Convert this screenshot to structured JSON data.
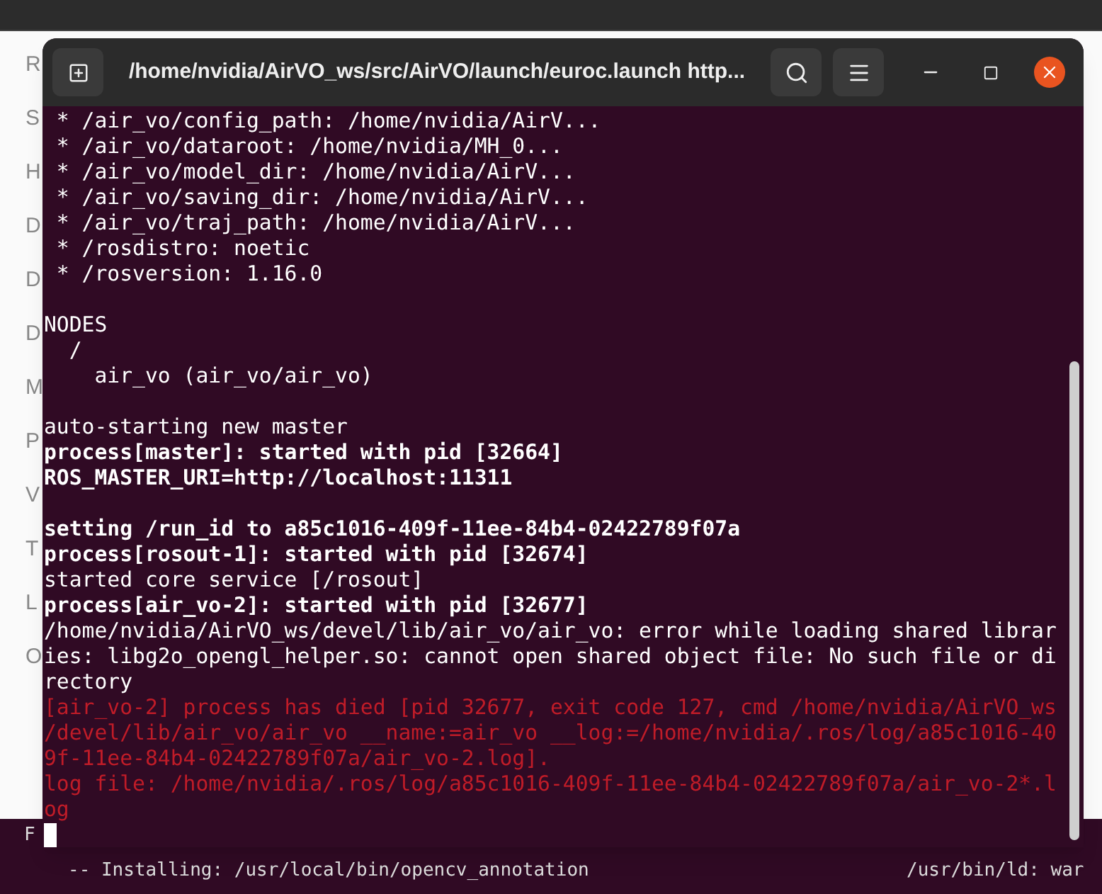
{
  "file_manager": {
    "sidebar_items": [
      {
        "label": "R"
      },
      {
        "label": "S"
      },
      {
        "label": "H"
      },
      {
        "label": "D"
      },
      {
        "label": "D"
      },
      {
        "label": "D"
      },
      {
        "label": "M"
      },
      {
        "label": "P"
      },
      {
        "label": "V"
      },
      {
        "label": "T"
      },
      {
        "label": "L"
      },
      {
        "label": "O"
      }
    ]
  },
  "back_terminal": {
    "lines": [
      "F",
      "-- Installing: /usr/local/bin/opencv_annotation"
    ],
    "right_text": "/usr/bin/ld: war"
  },
  "terminal": {
    "title": "/home/nvidia/AirVO_ws/src/AirVO/launch/euroc.launch http...",
    "lines": [
      {
        "kind": "normal",
        "text": " * /air_vo/config_path: /home/nvidia/AirV..."
      },
      {
        "kind": "normal",
        "text": " * /air_vo/dataroot: /home/nvidia/MH_0..."
      },
      {
        "kind": "normal",
        "text": " * /air_vo/model_dir: /home/nvidia/AirV..."
      },
      {
        "kind": "normal",
        "text": " * /air_vo/saving_dir: /home/nvidia/AirV..."
      },
      {
        "kind": "normal",
        "text": " * /air_vo/traj_path: /home/nvidia/AirV..."
      },
      {
        "kind": "normal",
        "text": " * /rosdistro: noetic"
      },
      {
        "kind": "normal",
        "text": " * /rosversion: 1.16.0"
      },
      {
        "kind": "gap"
      },
      {
        "kind": "normal",
        "text": "NODES"
      },
      {
        "kind": "normal",
        "text": "  /"
      },
      {
        "kind": "normal",
        "text": "    air_vo (air_vo/air_vo)"
      },
      {
        "kind": "gap"
      },
      {
        "kind": "normal",
        "text": "auto-starting new master"
      },
      {
        "kind": "bold",
        "text": "process[master]: started with pid [32664]"
      },
      {
        "kind": "bold",
        "text": "ROS_MASTER_URI=http://localhost:11311"
      },
      {
        "kind": "gap"
      },
      {
        "kind": "bold",
        "text": "setting /run_id to a85c1016-409f-11ee-84b4-02422789f07a"
      },
      {
        "kind": "bold",
        "text": "process[rosout-1]: started with pid [32674]"
      },
      {
        "kind": "normal",
        "text": "started core service [/rosout]"
      },
      {
        "kind": "bold",
        "text": "process[air_vo-2]: started with pid [32677]"
      },
      {
        "kind": "normal",
        "text": "/home/nvidia/AirVO_ws/devel/lib/air_vo/air_vo: error while loading shared librar"
      },
      {
        "kind": "normal",
        "text": "ies: libg2o_opengl_helper.so: cannot open shared object file: No such file or di"
      },
      {
        "kind": "normal",
        "text": "rectory"
      },
      {
        "kind": "error",
        "text": "[air_vo-2] process has died [pid 32677, exit code 127, cmd /home/nvidia/AirVO_ws"
      },
      {
        "kind": "error",
        "text": "/devel/lib/air_vo/air_vo __name:=air_vo __log:=/home/nvidia/.ros/log/a85c1016-40"
      },
      {
        "kind": "error",
        "text": "9f-11ee-84b4-02422789f07a/air_vo-2.log]."
      },
      {
        "kind": "error",
        "text": "log file: /home/nvidia/.ros/log/a85c1016-409f-11ee-84b4-02422789f07a/air_vo-2*.l"
      },
      {
        "kind": "error",
        "text": "og"
      },
      {
        "kind": "cursor"
      }
    ]
  }
}
